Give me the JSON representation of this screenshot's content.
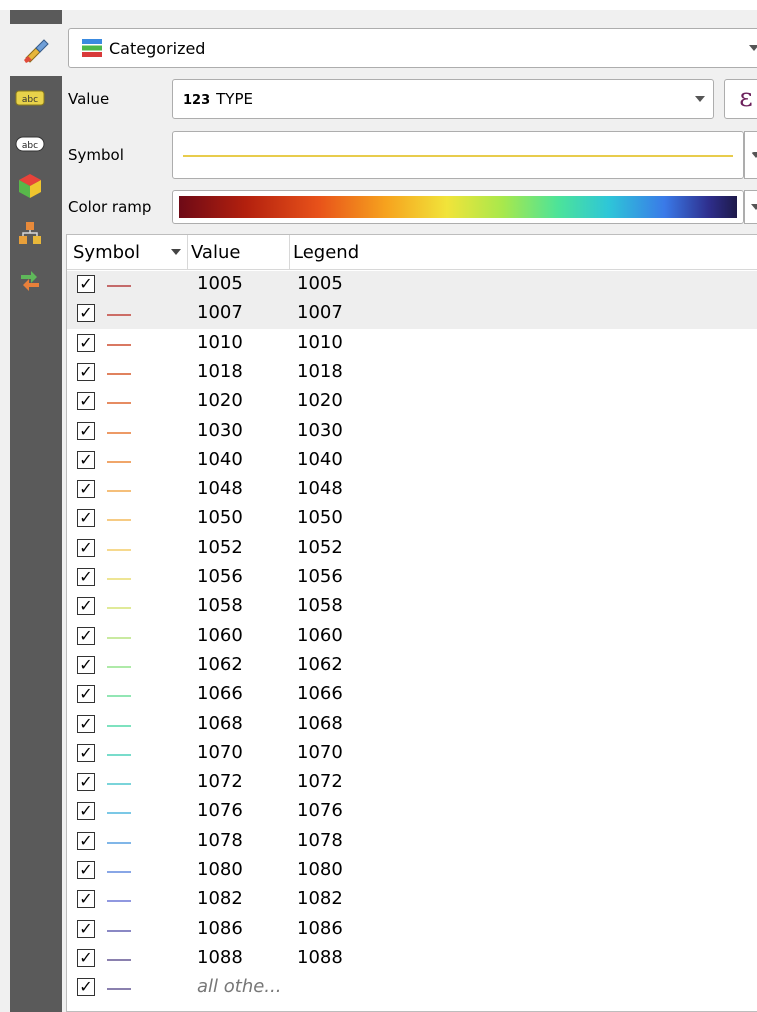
{
  "sidebar": {
    "icons": [
      {
        "name": "brush-icon"
      },
      {
        "name": "labels-icon"
      },
      {
        "name": "label-abc-icon"
      },
      {
        "name": "3d-box-icon"
      },
      {
        "name": "diagram-icon"
      },
      {
        "name": "arrows-icon"
      }
    ]
  },
  "renderer": {
    "label": "Categorized"
  },
  "value_field": {
    "label": "Value",
    "type_badge": "123",
    "field": "TYPE",
    "expression_glyph": "ε"
  },
  "symbol": {
    "label": "Symbol"
  },
  "color_ramp": {
    "label": "Color ramp"
  },
  "table": {
    "headers": [
      "Symbol",
      "Value",
      "Legend"
    ],
    "rows": [
      {
        "value": "1005",
        "legend": "1005",
        "color": "#c46a6a"
      },
      {
        "value": "1007",
        "legend": "1007",
        "color": "#cc6d66"
      },
      {
        "value": "1010",
        "legend": "1010",
        "color": "#d97862"
      },
      {
        "value": "1018",
        "legend": "1018",
        "color": "#e0825e"
      },
      {
        "value": "1020",
        "legend": "1020",
        "color": "#e68c62"
      },
      {
        "value": "1030",
        "legend": "1030",
        "color": "#ed9a66"
      },
      {
        "value": "1040",
        "legend": "1040",
        "color": "#f0a66a"
      },
      {
        "value": "1048",
        "legend": "1048",
        "color": "#f5bf7a"
      },
      {
        "value": "1050",
        "legend": "1050",
        "color": "#f6cb84"
      },
      {
        "value": "1052",
        "legend": "1052",
        "color": "#f6d98e"
      },
      {
        "value": "1056",
        "legend": "1056",
        "color": "#eee594"
      },
      {
        "value": "1058",
        "legend": "1058",
        "color": "#e0ea98"
      },
      {
        "value": "1060",
        "legend": "1060",
        "color": "#c9eaa0"
      },
      {
        "value": "1062",
        "legend": "1062",
        "color": "#aeeaa8"
      },
      {
        "value": "1066",
        "legend": "1066",
        "color": "#92e6b4"
      },
      {
        "value": "1068",
        "legend": "1068",
        "color": "#7ee2bf"
      },
      {
        "value": "1070",
        "legend": "1070",
        "color": "#78dccb"
      },
      {
        "value": "1072",
        "legend": "1072",
        "color": "#7ad4da"
      },
      {
        "value": "1076",
        "legend": "1076",
        "color": "#7bc8e6"
      },
      {
        "value": "1078",
        "legend": "1078",
        "color": "#80b6e8"
      },
      {
        "value": "1080",
        "legend": "1080",
        "color": "#88a6e6"
      },
      {
        "value": "1082",
        "legend": "1082",
        "color": "#9098e0"
      },
      {
        "value": "1086",
        "legend": "1086",
        "color": "#8a88c4"
      },
      {
        "value": "1088",
        "legend": "1088",
        "color": "#8a80ae"
      },
      {
        "value": "all othe...",
        "legend": "",
        "color": "#8a80ae",
        "italic": true
      }
    ]
  }
}
